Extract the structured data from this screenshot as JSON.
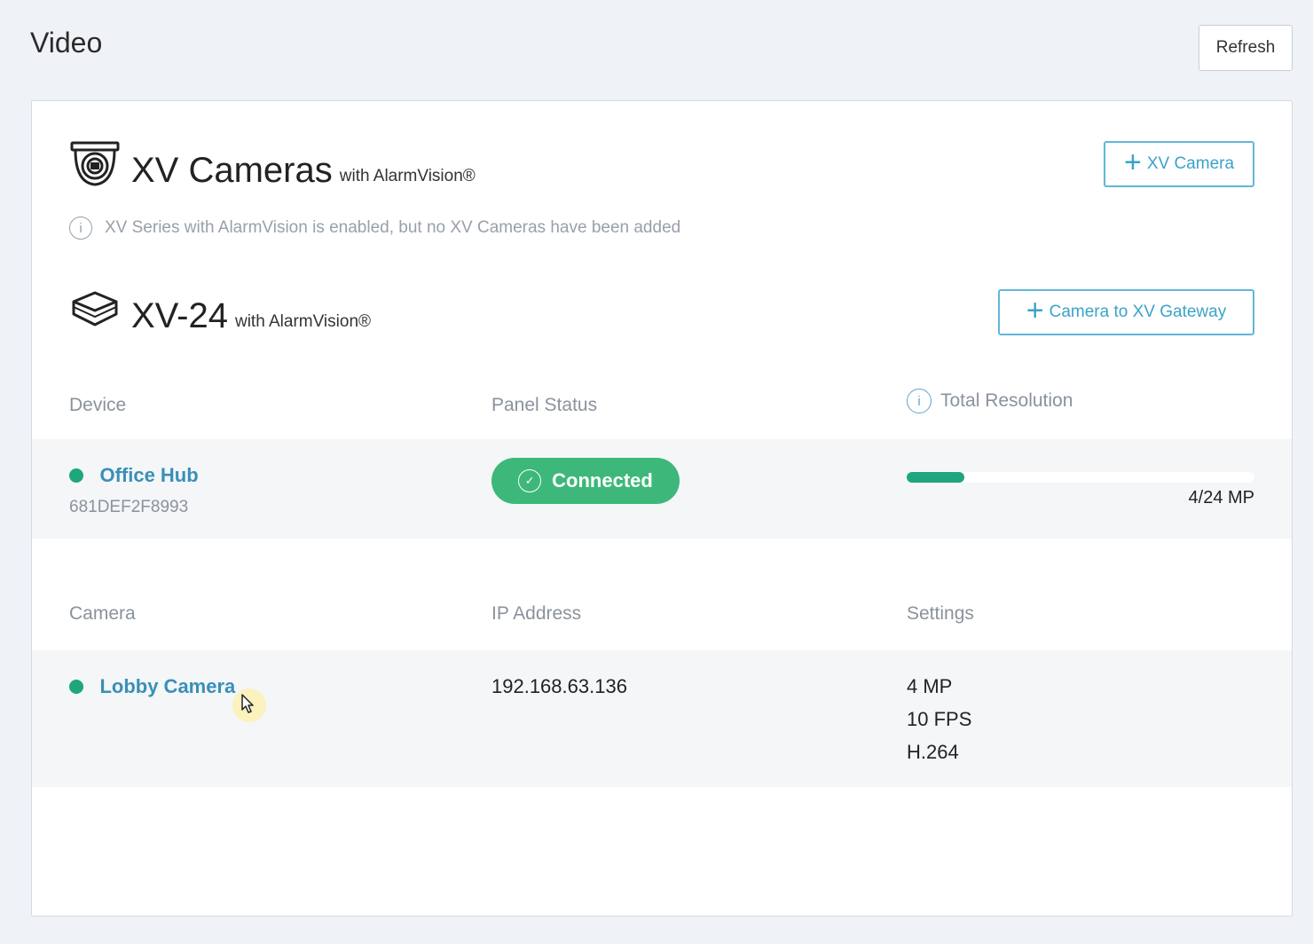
{
  "header": {
    "title": "Video",
    "refresh_label": "Refresh"
  },
  "xv_cameras": {
    "title": "XV Cameras",
    "subtitle": "with AlarmVision®",
    "add_button": "XV Camera",
    "info": "XV Series with AlarmVision is enabled, but no XV Cameras have been added"
  },
  "xv24": {
    "title": "XV-24",
    "subtitle": "with AlarmVision®",
    "add_button": "Camera to XV Gateway"
  },
  "device_table": {
    "headers": {
      "device": "Device",
      "panel_status": "Panel Status",
      "total_resolution": "Total Resolution"
    },
    "rows": [
      {
        "name": "Office Hub",
        "serial": "681DEF2F8993",
        "status": "Connected",
        "resolution_text": "4/24 MP",
        "resolution_fraction": 0.1667
      }
    ]
  },
  "camera_table": {
    "headers": {
      "camera": "Camera",
      "ip": "IP Address",
      "settings": "Settings"
    },
    "rows": [
      {
        "name": "Lobby Camera",
        "ip": "192.168.63.136",
        "settings": [
          "4 MP",
          "10 FPS",
          "H.264"
        ]
      }
    ]
  },
  "colors": {
    "accent": "#3aa3c8",
    "online": "#1fa67e",
    "connected": "#3db87a",
    "link": "#3a8fb7"
  }
}
